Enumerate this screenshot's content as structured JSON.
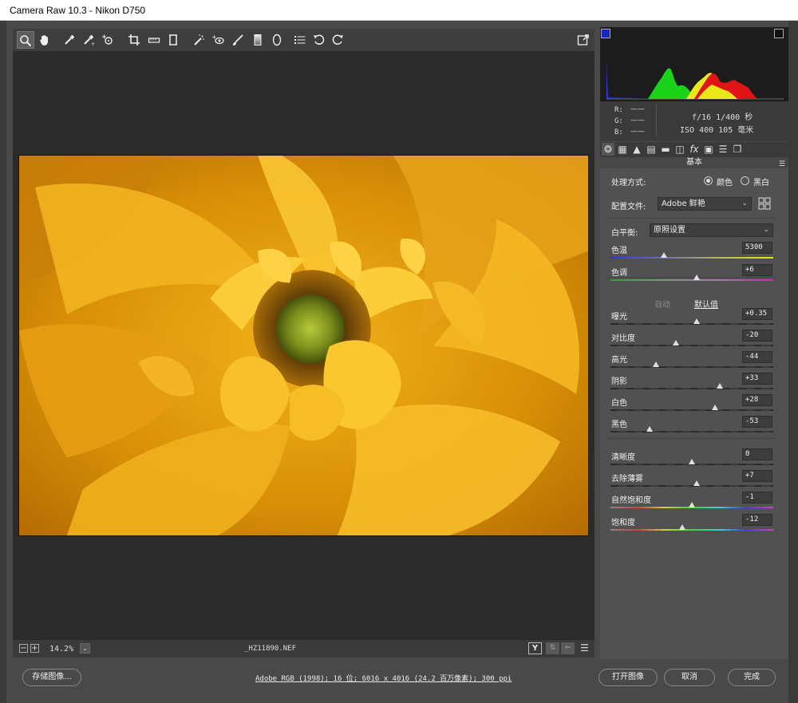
{
  "window": {
    "title": "Camera Raw 10.3 -  Nikon D750"
  },
  "toolbar": {
    "tools": [
      {
        "name": "zoom-tool",
        "glyph": "🔍"
      },
      {
        "name": "hand-tool",
        "glyph": "✋"
      },
      {
        "name": "white-balance-tool",
        "glyph": "⚗"
      },
      {
        "name": "color-sampler-tool",
        "glyph": "⚗"
      },
      {
        "name": "targeted-adjustment-tool",
        "glyph": "◎"
      },
      {
        "name": "crop-tool",
        "glyph": "⌗"
      },
      {
        "name": "straighten-tool",
        "glyph": "▭"
      },
      {
        "name": "transform-tool",
        "glyph": "⊡"
      },
      {
        "name": "spot-removal-tool",
        "glyph": "✎"
      },
      {
        "name": "red-eye-tool",
        "glyph": "◉"
      },
      {
        "name": "adjustment-brush-tool",
        "glyph": "🖌"
      },
      {
        "name": "graduated-filter-tool",
        "glyph": "▮"
      },
      {
        "name": "radial-filter-tool",
        "glyph": "○"
      },
      {
        "name": "preferences-tool",
        "glyph": "☰"
      },
      {
        "name": "rotate-left-tool",
        "glyph": "↺"
      },
      {
        "name": "rotate-right-tool",
        "glyph": "↻"
      }
    ],
    "fullscreen_glyph": "⇱"
  },
  "statusbar": {
    "zoom": "14.2%",
    "filename": "_HZ11890.NEF",
    "y_label": "Y"
  },
  "bottom": {
    "save_label": "存储图像...",
    "workflow_link": "Adobe RGB (1998); 16 位; 6016 x 4016 (24.2 百万像素); 300 ppi",
    "open_label": "打开图像",
    "cancel_label": "取消",
    "done_label": "完成"
  },
  "info": {
    "r_label": "R:",
    "g_label": "G:",
    "b_label": "B:",
    "r_val": "——",
    "g_val": "——",
    "b_val": "——",
    "aperture_shutter": "f/16  1/400 秒",
    "iso_focal": "ISO 400  105 毫米"
  },
  "panel": {
    "title": "基本",
    "treatment_label": "处理方式:",
    "color_label": "颜色",
    "bw_label": "黑白",
    "profile_label": "配置文件:",
    "profile_value": "Adobe 鲜艳",
    "wb_label": "白平衡:",
    "wb_value": "原照设置",
    "auto_label": "自动",
    "default_label": "默认值",
    "sliders": [
      {
        "label": "色温",
        "value": "5300",
        "pos": 0.33,
        "track": "temp"
      },
      {
        "label": "色调",
        "value": "+6",
        "pos": 0.53,
        "track": "tint"
      },
      {
        "label": "曝光",
        "value": "+0.35",
        "pos": 0.53,
        "track": "gray"
      },
      {
        "label": "对比度",
        "value": "-20",
        "pos": 0.4,
        "track": "gray"
      },
      {
        "label": "高光",
        "value": "-44",
        "pos": 0.28,
        "track": "gray"
      },
      {
        "label": "阴影",
        "value": "+33",
        "pos": 0.67,
        "track": "gray"
      },
      {
        "label": "白色",
        "value": "+28",
        "pos": 0.64,
        "track": "gray"
      },
      {
        "label": "黑色",
        "value": "-53",
        "pos": 0.24,
        "track": "gray"
      },
      {
        "label": "清晰度",
        "value": "0",
        "pos": 0.5,
        "track": "gray"
      },
      {
        "label": "去除薄雾",
        "value": "+7",
        "pos": 0.53,
        "track": "gray"
      },
      {
        "label": "自然饱和度",
        "value": "-1",
        "pos": 0.5,
        "track": "rainbow"
      },
      {
        "label": "饱和度",
        "value": "-12",
        "pos": 0.44,
        "track": "rainbow"
      }
    ]
  },
  "colors": {
    "accent_clip_shadow": "#1525c9",
    "histogram_green": "#19d219",
    "histogram_yellow": "#e8e81a",
    "histogram_red": "#e01414",
    "histogram_blue": "#2a3ae0"
  }
}
